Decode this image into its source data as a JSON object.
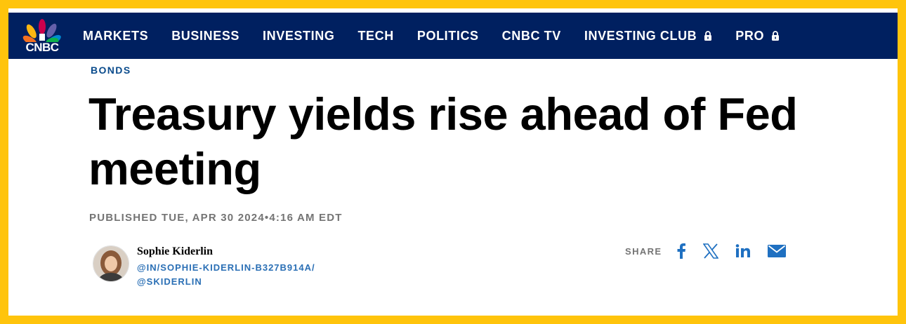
{
  "logo": {
    "text": "CNBC"
  },
  "nav": {
    "items": [
      {
        "label": "MARKETS",
        "locked": false
      },
      {
        "label": "BUSINESS",
        "locked": false
      },
      {
        "label": "INVESTING",
        "locked": false
      },
      {
        "label": "TECH",
        "locked": false
      },
      {
        "label": "POLITICS",
        "locked": false
      },
      {
        "label": "CNBC TV",
        "locked": false
      },
      {
        "label": "INVESTING CLUB",
        "locked": true
      },
      {
        "label": "PRO",
        "locked": true
      }
    ]
  },
  "article": {
    "section": "BONDS",
    "headline": "Treasury yields rise ahead of Fed meeting",
    "published": "PUBLISHED TUE, APR 30 2024•4:16 AM EDT"
  },
  "author": {
    "name": "Sophie Kiderlin",
    "linkedin": "@IN/SOPHIE-KIDERLIN-B327B914A/",
    "twitter": "@SKIDERLIN"
  },
  "share": {
    "label": "SHARE",
    "icons": [
      "facebook-icon",
      "x-icon",
      "linkedin-icon",
      "email-icon"
    ]
  },
  "colors": {
    "nav_bg": "#002060",
    "border": "#ffc40c",
    "section": "#0a4b8c",
    "link": "#2a6fb5",
    "share_icon": "#1f70c1"
  }
}
